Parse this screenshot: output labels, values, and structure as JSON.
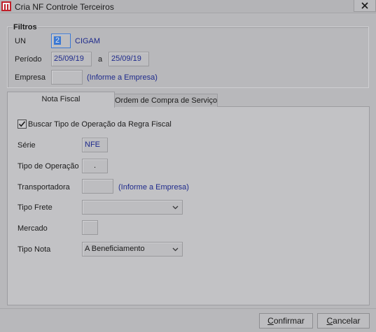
{
  "window": {
    "title": "Cria NF Controle Terceiros"
  },
  "filtros": {
    "group_title": "Filtros",
    "un_label": "UN",
    "un_value": "2",
    "un_name": "CIGAM",
    "periodo_label": "Período",
    "periodo_start": "25/09/19",
    "periodo_sep": "a",
    "periodo_end": "25/09/19",
    "empresa_label": "Empresa",
    "empresa_value": "",
    "empresa_hint": "(Informe a Empresa)"
  },
  "tabs": [
    {
      "label": "Nota Fiscal",
      "active": true
    },
    {
      "label": "Ordem de Compra de Serviço",
      "active": false
    }
  ],
  "nota_fiscal": {
    "buscar_checkbox_label": "Buscar Tipo de Operação da Regra Fiscal",
    "buscar_checked": true,
    "serie_label": "Série",
    "serie_value": "NFE",
    "tipo_operacao_label": "Tipo de Operação",
    "tipo_operacao_value": ".",
    "transportadora_label": "Transportadora",
    "transportadora_value": "",
    "transportadora_hint": "(Informe a Empresa)",
    "tipo_frete_label": "Tipo Frete",
    "tipo_frete_value": "",
    "mercado_label": "Mercado",
    "mercado_value": "",
    "tipo_nota_label": "Tipo Nota",
    "tipo_nota_value": "A Beneficiamento"
  },
  "buttons": {
    "confirmar_mnemonic": "C",
    "confirmar_rest": "onfirmar",
    "cancelar_mnemonic": "C",
    "cancelar_rest": "ancelar"
  },
  "icons": {
    "app": "app-logo-icon",
    "close": "close-icon",
    "dropdown": "chevron-down-icon",
    "check": "checkmark-icon"
  },
  "colors": {
    "background": "#b8b8bb",
    "link_text": "#1e2a8c",
    "focus_border": "#3a78d4",
    "app_icon_red": "#c0202a"
  }
}
